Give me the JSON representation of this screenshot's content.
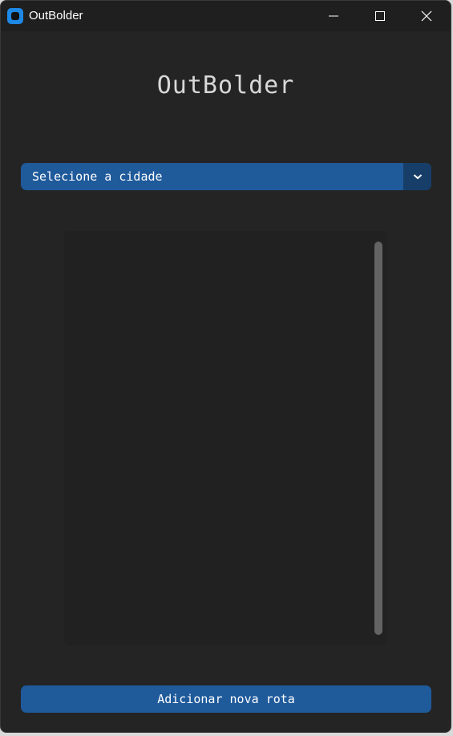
{
  "window": {
    "title": "OutBolder",
    "icon": "app-icon",
    "controls": [
      "minimize-icon",
      "maximize-icon",
      "close-icon"
    ]
  },
  "main": {
    "heading": "OutBolder",
    "city_select": {
      "value": "Selecione a cidade",
      "arrow_icon": "chevron-down-icon"
    },
    "route_list": {
      "items": []
    },
    "add_button_label": "Adicionar nova rota"
  },
  "colors": {
    "background": "#242424",
    "titlebar": "#1f1f1f",
    "accent": "#1f5a9b",
    "accent_dark": "#173e69",
    "list_background": "#212121",
    "scrollbar": "#636363",
    "text": "#ffffff",
    "heading_text": "#d8d8d8"
  }
}
